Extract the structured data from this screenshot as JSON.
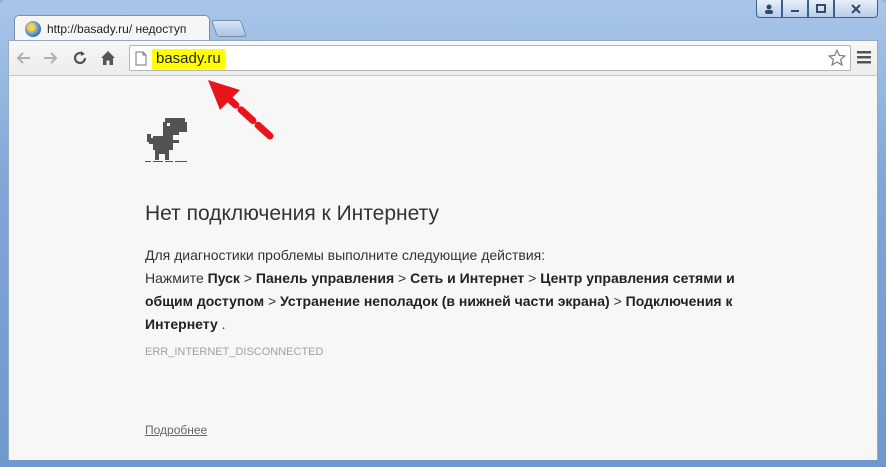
{
  "window": {
    "tab_title": "http://basady.ru/ недоступ",
    "caption": {
      "user_icon": "user-icon",
      "minimize_icon": "minimize-icon",
      "maximize_icon": "maximize-icon",
      "close_icon": "close-icon"
    }
  },
  "toolbar": {
    "back_icon": "back-arrow-icon",
    "forward_icon": "forward-arrow-icon",
    "reload_icon": "reload-icon",
    "home_icon": "home-icon",
    "url": "basady.ru",
    "star_icon": "star-icon",
    "menu_icon": "hamburger-menu-icon",
    "url_highlight_color": "#ffff00"
  },
  "page": {
    "heading": "Нет подключения к Интернету",
    "intro": "Для диагностики проблемы выполните следующие действия:",
    "steps": {
      "prefix": "Нажмите",
      "s1": "Пуск",
      "sep": ">",
      "s2": "Панель управления",
      "s3": "Сеть и Интернет",
      "s4": "Центр управления сетями и общим доступом",
      "s5": "Устранение неполадок (в нижней части экрана)",
      "s6": "Подключения к Интернету",
      "end": "."
    },
    "error_code": "ERR_INTERNET_DISCONNECTED",
    "more_link": "Подробнее"
  },
  "annotation": {
    "arrow_color": "#e8141c"
  }
}
